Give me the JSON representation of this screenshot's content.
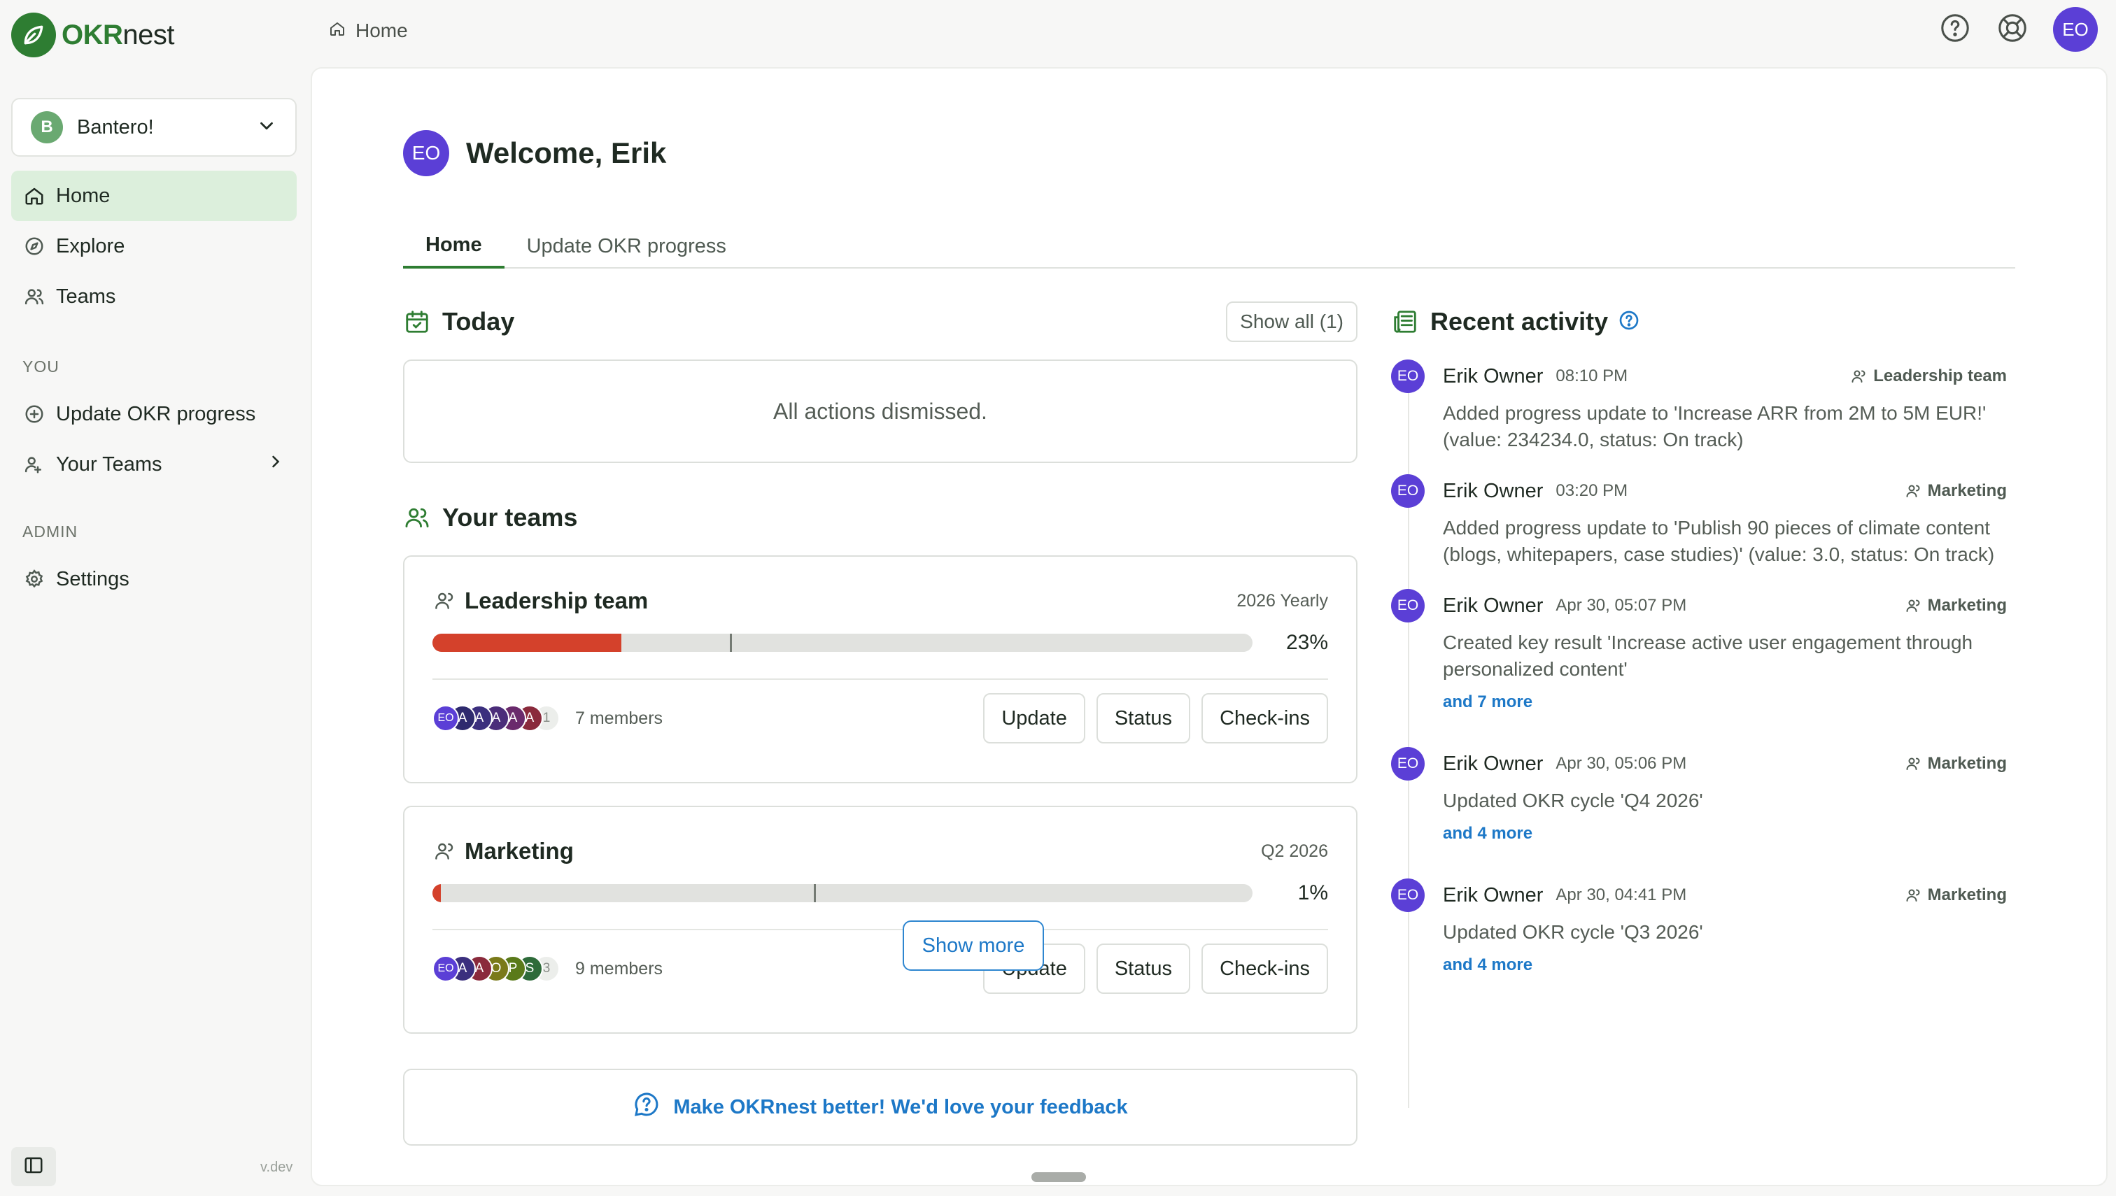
{
  "app": {
    "logo_bold": "OKR",
    "logo_light": "nest",
    "version": "v.dev"
  },
  "org": {
    "badge": "B",
    "name": "Bantero!"
  },
  "sidebar": {
    "nav": [
      {
        "label": "Home",
        "icon": "home-icon",
        "active": true
      },
      {
        "label": "Explore",
        "icon": "compass-icon"
      },
      {
        "label": "Teams",
        "icon": "users-icon"
      }
    ],
    "section_you": "YOU",
    "you_items": [
      {
        "label": "Update OKR progress",
        "icon": "plus-circle-icon"
      },
      {
        "label": "Your Teams",
        "icon": "user-group-icon"
      }
    ],
    "section_admin": "ADMIN",
    "admin_items": [
      {
        "label": "Settings",
        "icon": "gear-icon"
      }
    ]
  },
  "topbar": {
    "breadcrumb": "Home",
    "avatar": "EO"
  },
  "welcome": {
    "avatar": "EO",
    "title": "Welcome, Erik"
  },
  "tabs": [
    {
      "label": "Home",
      "active": true
    },
    {
      "label": "Update OKR progress"
    }
  ],
  "today": {
    "title": "Today",
    "show_all": "Show all (1)",
    "empty": "All actions dismissed."
  },
  "your_teams": {
    "title": "Your teams",
    "teams": [
      {
        "name": "Leadership team",
        "period": "2026 Yearly",
        "percent": "23%",
        "progress": 0.23,
        "marker": 0.363,
        "members": "7 members",
        "avatars": [
          {
            "t": "EO",
            "c": "#5b3fd6"
          },
          {
            "t": "A",
            "c": "#2e2a6e"
          },
          {
            "t": "A",
            "c": "#3b2f7e"
          },
          {
            "t": "A",
            "c": "#4b2d7a"
          },
          {
            "t": "A",
            "c": "#6a2a6c"
          },
          {
            "t": "A",
            "c": "#8a2a3c"
          }
        ],
        "more": "1"
      },
      {
        "name": "Marketing",
        "period": "Q2 2026",
        "percent": "1%",
        "progress": 0.01,
        "marker": 0.465,
        "members": "9 members",
        "avatars": [
          {
            "t": "EO",
            "c": "#5b3fd6"
          },
          {
            "t": "A",
            "c": "#3b2f7e"
          },
          {
            "t": "A",
            "c": "#8a2a3c"
          },
          {
            "t": "O",
            "c": "#7a7a1a"
          },
          {
            "t": "P",
            "c": "#5a7a1a"
          },
          {
            "t": "S",
            "c": "#2e6b3a"
          }
        ],
        "more": "3"
      }
    ],
    "buttons": {
      "update": "Update",
      "status": "Status",
      "checkins": "Check-ins"
    }
  },
  "feedback": "Make OKRnest better! We'd love your feedback",
  "activity": {
    "title": "Recent activity",
    "items": [
      {
        "avatar": "EO",
        "name": "Erik Owner",
        "time": "08:10 PM",
        "team": "Leadership team",
        "text": "Added progress update to 'Increase ARR from 2M to 5M EUR!' (value: 234234.0, status: On track)",
        "more": ""
      },
      {
        "avatar": "EO",
        "name": "Erik Owner",
        "time": "03:20 PM",
        "team": "Marketing",
        "text": "Added progress update to 'Publish 90 pieces of climate content (blogs, whitepapers, case studies)' (value: 3.0, status: On track)",
        "more": ""
      },
      {
        "avatar": "EO",
        "name": "Erik Owner",
        "time": "Apr 30, 05:07 PM",
        "team": "Marketing",
        "text": "Created key result 'Increase active user engagement through personalized content'",
        "more": "and 7 more"
      },
      {
        "avatar": "EO",
        "name": "Erik Owner",
        "time": "Apr 30, 05:06 PM",
        "team": "Marketing",
        "text": "Updated OKR cycle 'Q4 2026'",
        "more": "and 4 more"
      },
      {
        "avatar": "EO",
        "name": "Erik Owner",
        "time": "Apr 30, 04:41 PM",
        "team": "Marketing",
        "text": "Updated OKR cycle 'Q3 2026'",
        "more": "and 4 more"
      }
    ],
    "show_more": "Show more"
  },
  "colors": {
    "brand": "#2e7d32",
    "progress": "#d4412b",
    "link": "#1d78c7",
    "avatar": "#5b3fd6"
  }
}
